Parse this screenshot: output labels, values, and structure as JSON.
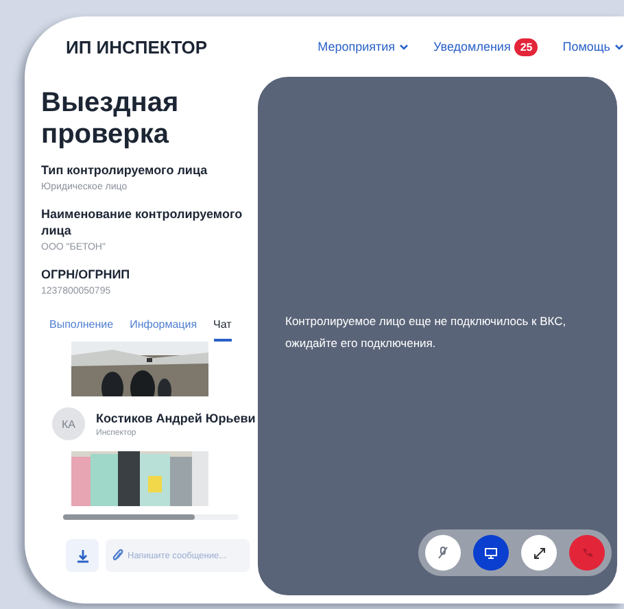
{
  "header": {
    "logo": "ИП ИНСПЕКТОР",
    "nav": [
      {
        "label": "Мероприятия",
        "kind": "dropdown"
      },
      {
        "label": "Уведомления",
        "kind": "badge",
        "badge": "25"
      },
      {
        "label": "Помощь",
        "kind": "dropdown"
      }
    ]
  },
  "inspection": {
    "title": "Выездная проверка",
    "fields": [
      {
        "label": "Тип контролируемого лица",
        "value": "Юридическое лицо"
      },
      {
        "label": "Наименование контролируемого лица",
        "value": "ООО \"БЕТОН\""
      },
      {
        "label": "ОГРН/ОГРНИП",
        "value": "1237800050795"
      }
    ]
  },
  "tabs": [
    {
      "label": "Выполнение",
      "selected": false
    },
    {
      "label": "Информация",
      "selected": false
    },
    {
      "label": "Чат",
      "selected": true
    }
  ],
  "chat": {
    "author": {
      "initials": "КА",
      "name": "Костиков Андрей Юрьеви",
      "role": "Инспектор"
    },
    "input": {
      "placeholder": "Напишите сообщение..."
    }
  },
  "video": {
    "message": "Контролируемое лицо еще не подключилось к ВКС, ожидайте его подключения.",
    "controls": [
      {
        "kind": "mic",
        "active": false
      },
      {
        "kind": "screen",
        "active": true
      },
      {
        "kind": "expand",
        "active": false
      },
      {
        "kind": "hangup",
        "active": false
      }
    ]
  }
}
